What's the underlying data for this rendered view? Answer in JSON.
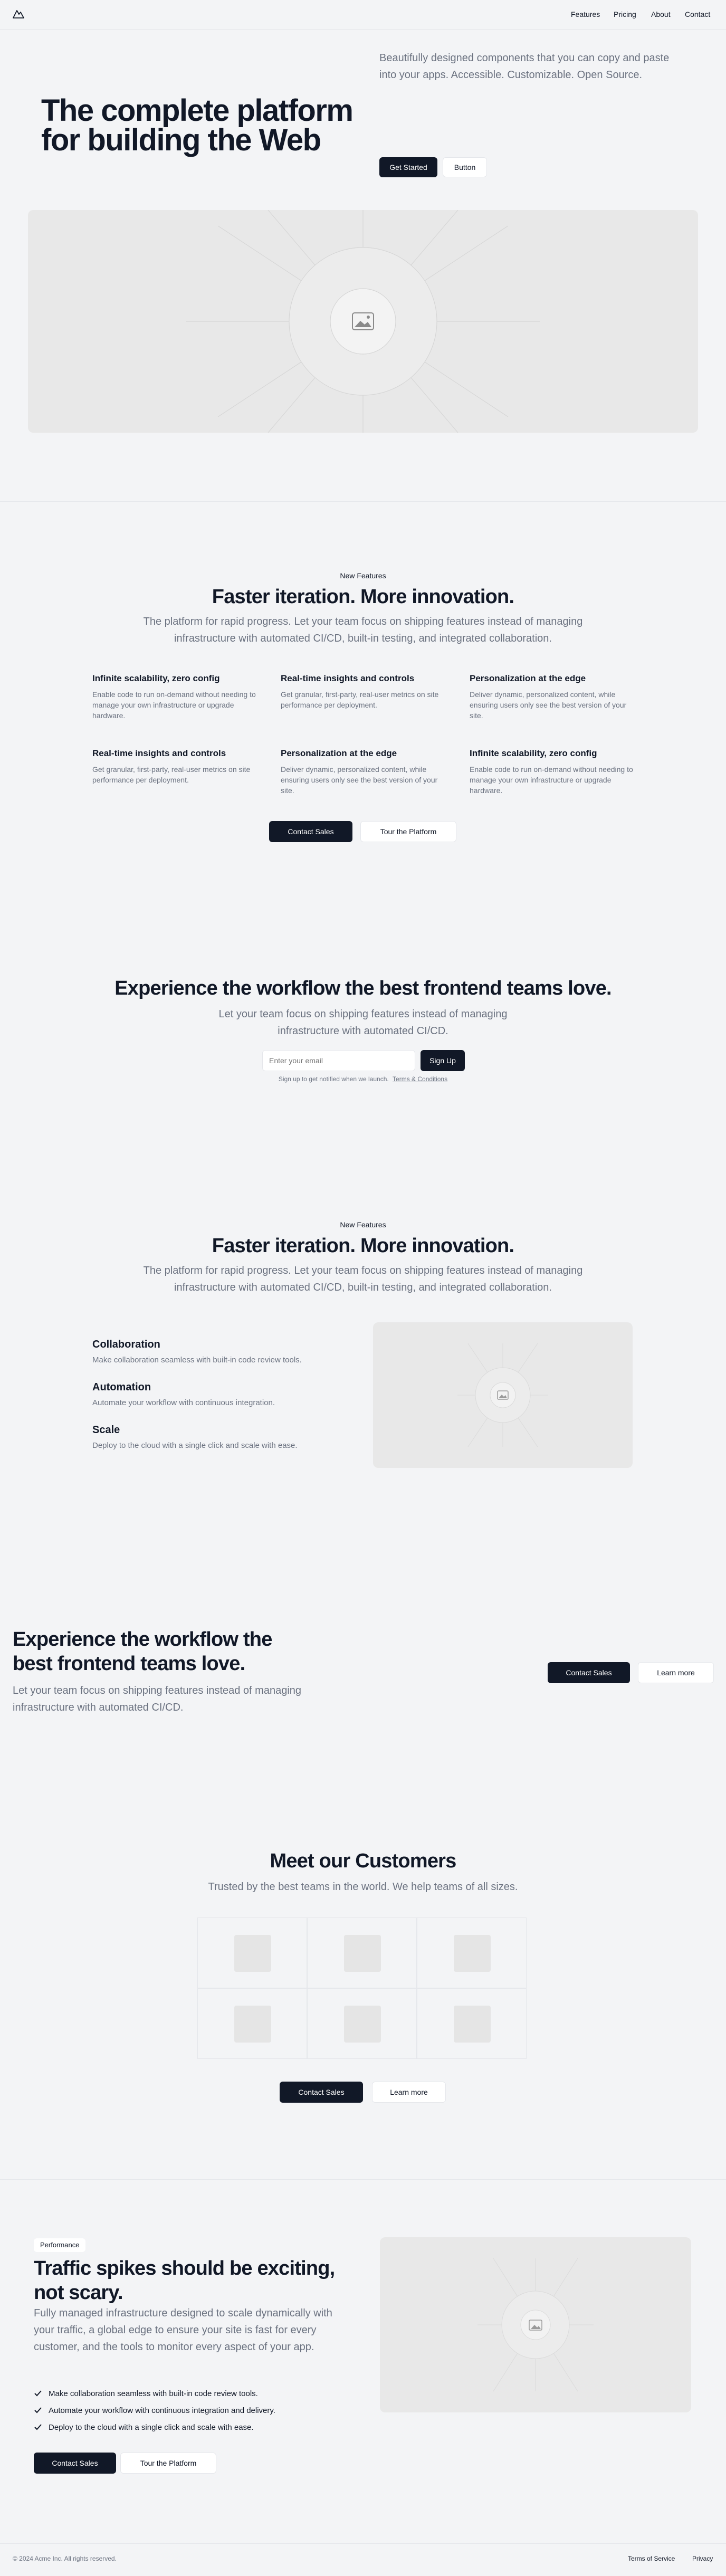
{
  "header": {
    "logo_icon": "mountain-icon",
    "nav": [
      "Features",
      "Pricing",
      "About",
      "Contact"
    ]
  },
  "hero": {
    "title": "The complete platform for building the Web",
    "description": "Beautifully designed components that you can copy and paste into your apps. Accessible. Customizable. Open Source.",
    "primary_button": "Get Started",
    "secondary_button": "Button"
  },
  "features1": {
    "eyebrow": "New Features",
    "title": "Faster iteration. More innovation.",
    "subtitle": "The platform for rapid progress. Let your team focus on shipping features instead of managing infrastructure with automated CI/CD, built-in testing, and integrated collaboration.",
    "items": [
      {
        "title": "Infinite scalability, zero config",
        "desc": "Enable code to run on-demand without needing to manage your own infrastructure or upgrade hardware."
      },
      {
        "title": "Real-time insights and controls",
        "desc": "Get granular, first-party, real-user metrics on site performance per deployment."
      },
      {
        "title": "Personalization at the edge",
        "desc": "Deliver dynamic, personalized content, while ensuring users only see the best version of your site."
      },
      {
        "title": "Real-time insights and controls",
        "desc": "Get granular, first-party, real-user metrics on site performance per deployment."
      },
      {
        "title": "Personalization at the edge",
        "desc": "Deliver dynamic, personalized content, while ensuring users only see the best version of your site."
      },
      {
        "title": "Infinite scalability, zero config",
        "desc": "Enable code to run on-demand without needing to manage your own infrastructure or upgrade hardware."
      }
    ],
    "primary_button": "Contact Sales",
    "secondary_button": "Tour the Platform"
  },
  "signup": {
    "title": "Experience the workflow the best frontend teams love.",
    "subtitle": "Let your team focus on shipping features instead of managing infrastructure with automated CI/CD.",
    "email_placeholder": "Enter your email",
    "button": "Sign Up",
    "note": "Sign up to get notified when we launch.",
    "terms_link": "Terms & Conditions"
  },
  "features2": {
    "eyebrow": "New Features",
    "title": "Faster iteration. More innovation.",
    "subtitle": "The platform for rapid progress. Let your team focus on shipping features instead of managing infrastructure with automated CI/CD, built-in testing, and integrated collaboration.",
    "items": [
      {
        "title": "Collaboration",
        "desc": "Make collaboration seamless with built-in code review tools."
      },
      {
        "title": "Automation",
        "desc": "Automate your workflow with continuous integration."
      },
      {
        "title": "Scale",
        "desc": "Deploy to the cloud with a single click and scale with ease."
      }
    ]
  },
  "cta": {
    "title": "Experience the workflow the best frontend teams love.",
    "subtitle": "Let your team focus on shipping features instead of managing infrastructure with automated CI/CD.",
    "primary_button": "Contact Sales",
    "secondary_button": "Learn more"
  },
  "customers": {
    "title": "Meet our Customers",
    "subtitle": "Trusted by the best teams in the world. We help teams of all sizes.",
    "primary_button": "Contact Sales",
    "secondary_button": "Learn more"
  },
  "performance": {
    "badge": "Performance",
    "title": "Traffic spikes should be exciting, not scary.",
    "description": "Fully managed infrastructure designed to scale dynamically with your traffic, a global edge to ensure your site is fast for every customer, and the tools to monitor every aspect of your app.",
    "checklist": [
      "Make collaboration seamless with built-in code review tools.",
      "Automate your workflow with continuous integration and delivery.",
      "Deploy to the cloud with a single click and scale with ease."
    ],
    "primary_button": "Contact Sales",
    "secondary_button": "Tour the Platform"
  },
  "footer": {
    "copyright": "© 2024 Acme Inc. All rights reserved.",
    "links": [
      "Terms of Service",
      "Privacy"
    ]
  },
  "colors": {
    "page_bg": "#f3f4f6",
    "primary": "#111827",
    "muted_text": "#6b7280",
    "placeholder": "#e8e8e8"
  }
}
